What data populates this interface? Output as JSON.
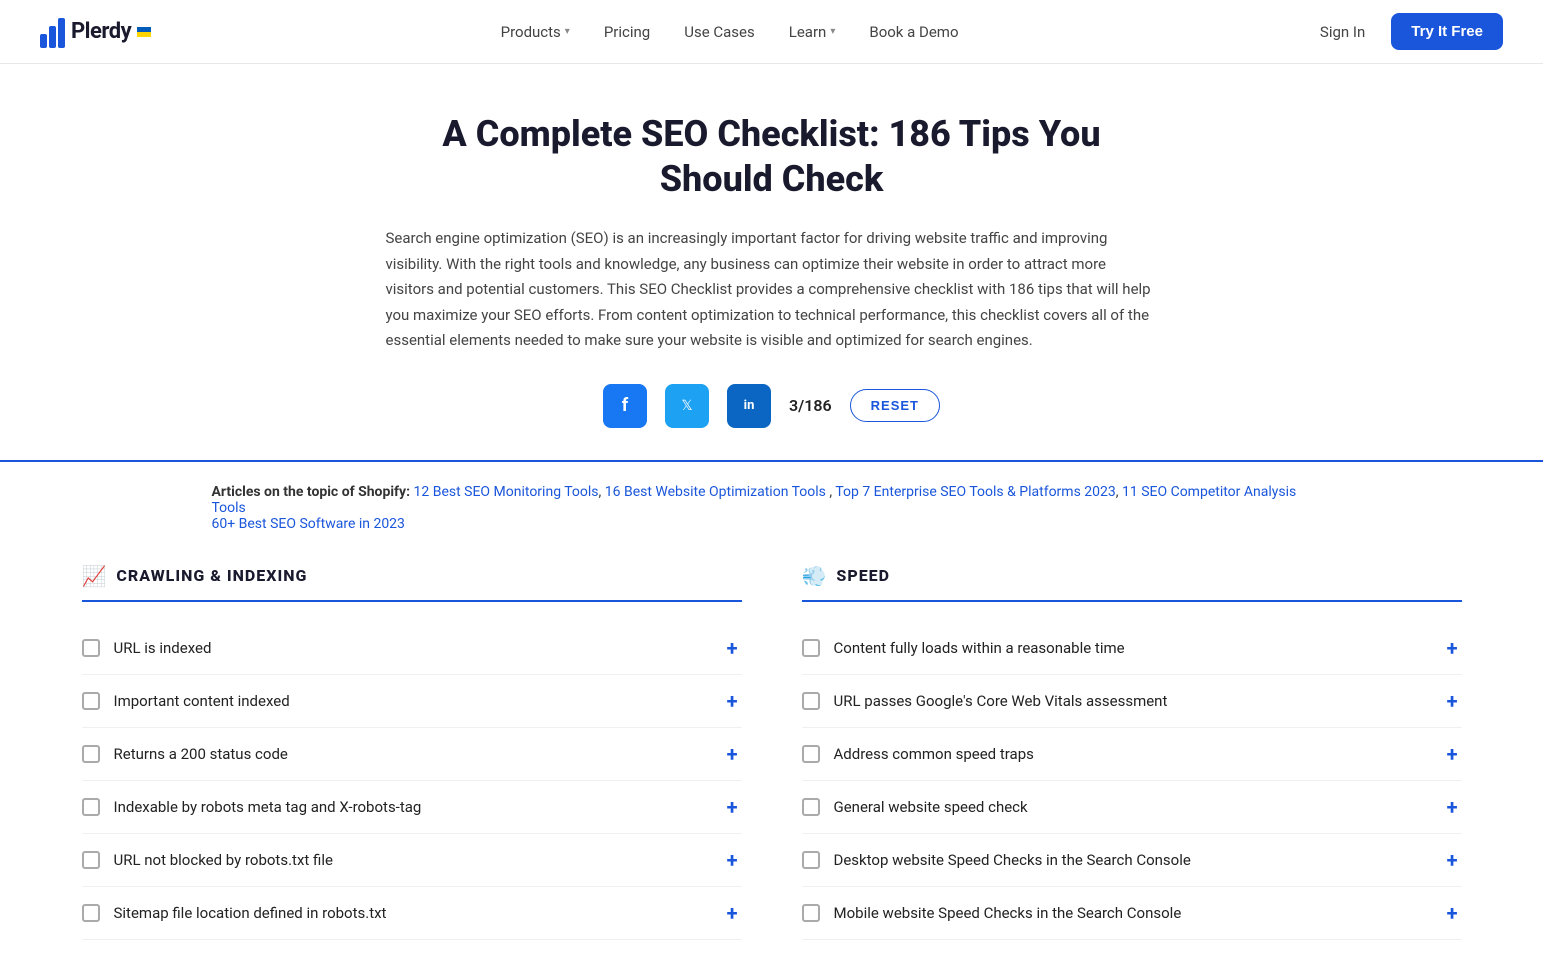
{
  "header": {
    "logo_text": "Plerdy",
    "nav_items": [
      {
        "label": "Products",
        "has_chevron": true
      },
      {
        "label": "Pricing",
        "has_chevron": false
      },
      {
        "label": "Use Cases",
        "has_chevron": false
      },
      {
        "label": "Learn",
        "has_chevron": true
      },
      {
        "label": "Book a Demo",
        "has_chevron": false
      }
    ],
    "sign_in": "Sign In",
    "try_free": "Try It Free"
  },
  "hero": {
    "title": "A Complete SEO Checklist: 186 Tips You Should Check",
    "description": "Search engine optimization (SEO) is an increasingly important factor for driving website traffic and improving visibility. With the right tools and knowledge, any business can optimize their website in order to attract more visitors and potential customers. This SEO Checklist provides a comprehensive checklist with 186 tips that will help you maximize your SEO efforts. From content optimization to technical performance, this checklist covers all of the essential elements needed to make sure your website is visible and optimized for search engines.",
    "counter": "3/186",
    "reset_label": "RESET",
    "social": {
      "facebook_label": "f",
      "twitter_label": "t",
      "linkedin_label": "in"
    }
  },
  "articles": {
    "prefix": "Articles on the topic of Shopify:",
    "links": [
      "12 Best SEO Monitoring Tools",
      "16 Best Website Optimization Tools",
      "Top 7 Enterprise SEO Tools & Platforms 2023",
      "11 SEO Competitor Analysis Tools",
      "60+ Best SEO Software in 2023"
    ]
  },
  "crawling_section": {
    "icon": "📈",
    "title": "CRAWLING & INDEXING",
    "items": [
      "URL is indexed",
      "Important content indexed",
      "Returns a 200 status code",
      "Indexable by robots meta tag and X-robots-tag",
      "URL not blocked by robots.txt file",
      "Sitemap file location defined in robots.txt"
    ]
  },
  "speed_section": {
    "icon": "💨",
    "title": "SPEED",
    "items": [
      "Content fully loads within a reasonable time",
      "URL passes Google's Core Web Vitals assessment",
      "Address common speed traps",
      "General website speed check",
      "Desktop website Speed Checks in the Search Console",
      "Mobile website Speed Checks in the Search Console"
    ]
  }
}
